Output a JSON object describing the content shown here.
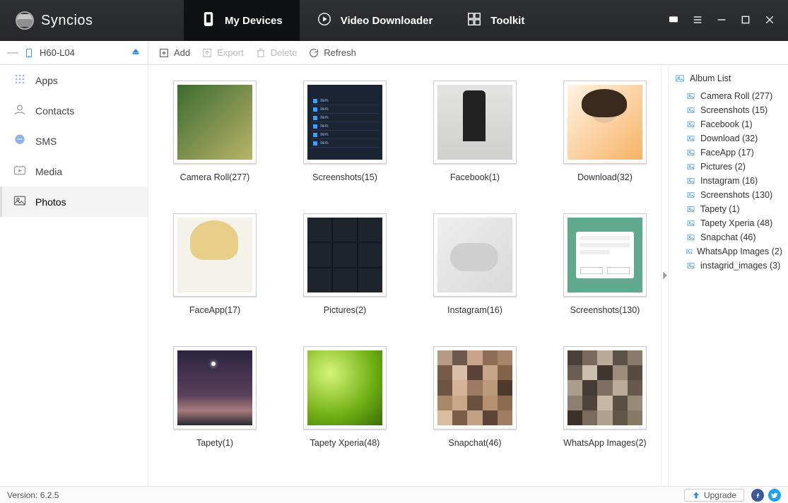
{
  "app": {
    "name": "Syncios"
  },
  "tabs": [
    {
      "label": "My Devices"
    },
    {
      "label": "Video Downloader"
    },
    {
      "label": "Toolkit"
    }
  ],
  "device": {
    "name": "H60-L04"
  },
  "toolbar": {
    "add": "Add",
    "export": "Export",
    "delete": "Delete",
    "refresh": "Refresh"
  },
  "sidebar": {
    "items": [
      {
        "label": "Apps"
      },
      {
        "label": "Contacts"
      },
      {
        "label": "SMS"
      },
      {
        "label": "Media"
      },
      {
        "label": "Photos"
      }
    ]
  },
  "albums": [
    {
      "name": "Camera Roll",
      "count": 277,
      "thumb": "figures"
    },
    {
      "name": "Screenshots",
      "count": 15,
      "thumb": "settings"
    },
    {
      "name": "Facebook",
      "count": 1,
      "thumb": "chair"
    },
    {
      "name": "Download",
      "count": 32,
      "thumb": "portrait"
    },
    {
      "name": "FaceApp",
      "count": 17,
      "thumb": "blonde"
    },
    {
      "name": "Pictures",
      "count": 2,
      "thumb": "grid3"
    },
    {
      "name": "Instagram",
      "count": 16,
      "thumb": "controller"
    },
    {
      "name": "Screenshots",
      "count": 130,
      "thumb": "dialog"
    },
    {
      "name": "Tapety",
      "count": 1,
      "thumb": "night"
    },
    {
      "name": "Tapety Xperia",
      "count": 48,
      "thumb": "green"
    },
    {
      "name": "Snapchat",
      "count": 46,
      "thumb": "pixel1"
    },
    {
      "name": "WhatsApp Images",
      "count": 2,
      "thumb": "pixel2"
    }
  ],
  "albumlist": {
    "header": "Album List",
    "items": [
      {
        "name": "Camera Roll",
        "count": 277
      },
      {
        "name": "Screenshots",
        "count": 15
      },
      {
        "name": "Facebook",
        "count": 1
      },
      {
        "name": "Download",
        "count": 32
      },
      {
        "name": "FaceApp",
        "count": 17
      },
      {
        "name": "Pictures",
        "count": 2
      },
      {
        "name": "Instagram",
        "count": 16
      },
      {
        "name": "Screenshots",
        "count": 130
      },
      {
        "name": "Tapety",
        "count": 1
      },
      {
        "name": "Tapety Xperia",
        "count": 48
      },
      {
        "name": "Snapchat",
        "count": 46
      },
      {
        "name": "WhatsApp Images",
        "count": 2
      },
      {
        "name": "instagrid_images",
        "count": 3
      }
    ]
  },
  "footer": {
    "version": "Version: 6.2.5",
    "upgrade": "Upgrade"
  }
}
